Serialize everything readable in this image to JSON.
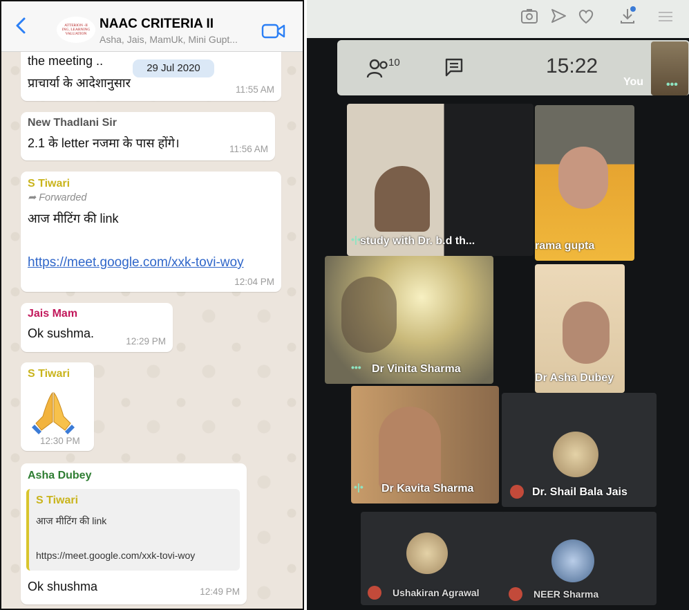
{
  "chat": {
    "header": {
      "title": "NAAC CRITERIA II",
      "subtitle": "Asha, Jais, MamUk, Mini Gupt...",
      "avatar_lines": [
        "ATTERION -II",
        "ING, LEARNING",
        "VALUATION"
      ]
    },
    "date_chip": "29 Jul 2020",
    "messages": [
      {
        "lines": [
          "the meeting ..",
          "प्राचार्या के आदेशानुसार"
        ],
        "time": "11:55 AM"
      },
      {
        "sender": "New Thadlani Sir",
        "text": "2.1 के letter नजमा के पास होंगे।",
        "time": "11:56 AM"
      },
      {
        "sender": "S Tiwari",
        "forwarded": "Forwarded",
        "text": "आज मीटिंग की link",
        "link": "https://meet.google.com/xxk-tovi-woy",
        "time": "12:04 PM"
      },
      {
        "sender": "Jais Mam",
        "text": "Ok sushma.",
        "time": "12:29 PM"
      },
      {
        "sender": "S Tiwari",
        "emoji": "folded-hands",
        "time": "12:30 PM"
      },
      {
        "sender": "Asha Dubey",
        "quote_sender": "S Tiwari",
        "quote_text": "आज मीटिंग की link",
        "quote_link": "https://meet.google.com/xxk-tovi-woy",
        "text": "Ok shushma",
        "time": "12:49 PM"
      }
    ],
    "colors": {
      "s_tiwari": "#c9b41c",
      "thadlani": "#555555",
      "jais": "#c2185b",
      "asha": "#2e7d32",
      "link": "#2f66c9"
    }
  },
  "meet": {
    "participant_count": "10",
    "time": "15:22",
    "self_label": "You",
    "tiles": [
      {
        "name": "study with Dr. b.d th..."
      },
      {
        "name": "rama gupta"
      },
      {
        "name": "Dr Vinita Sharma"
      },
      {
        "name": "Dr Asha Dubey"
      },
      {
        "name": "Dr Kavita Sharma"
      },
      {
        "name": "Dr. Shail Bala Jais"
      },
      {
        "name": "Ushakiran Agrawal"
      },
      {
        "name": "NEER Sharma"
      }
    ]
  }
}
